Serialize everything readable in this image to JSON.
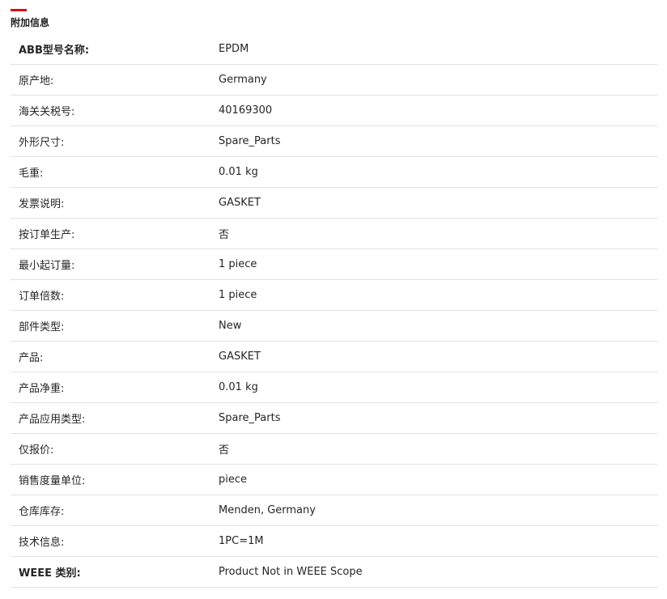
{
  "section": {
    "title": "附加信息",
    "accent_color": "#e2001a"
  },
  "rows": [
    {
      "label": "ABB型号名称:",
      "value": "EPDM"
    },
    {
      "label": "原产地:",
      "value": "Germany"
    },
    {
      "label": "海关关税号:",
      "value": "40169300"
    },
    {
      "label": "外形尺寸:",
      "value": "Spare_Parts"
    },
    {
      "label": "毛重:",
      "value": "0.01 kg"
    },
    {
      "label": "发票说明:",
      "value": "GASKET"
    },
    {
      "label": "按订单生产:",
      "value": "否"
    },
    {
      "label": "最小起订量:",
      "value": "1 piece"
    },
    {
      "label": "订单倍数:",
      "value": "1 piece"
    },
    {
      "label": "部件类型:",
      "value": "New"
    },
    {
      "label": "产品:",
      "value": "GASKET"
    },
    {
      "label": "产品净重:",
      "value": "0.01 kg"
    },
    {
      "label": "产品应用类型:",
      "value": "Spare_Parts"
    },
    {
      "label": "仅报价:",
      "value": "否"
    },
    {
      "label": "销售度量单位:",
      "value": "piece"
    },
    {
      "label": "仓库库存:",
      "value": "Menden, Germany"
    },
    {
      "label": "技术信息:",
      "value": "1PC=1M"
    },
    {
      "label": "WEEE 类别:",
      "value": "Product Not in WEEE Scope"
    }
  ]
}
